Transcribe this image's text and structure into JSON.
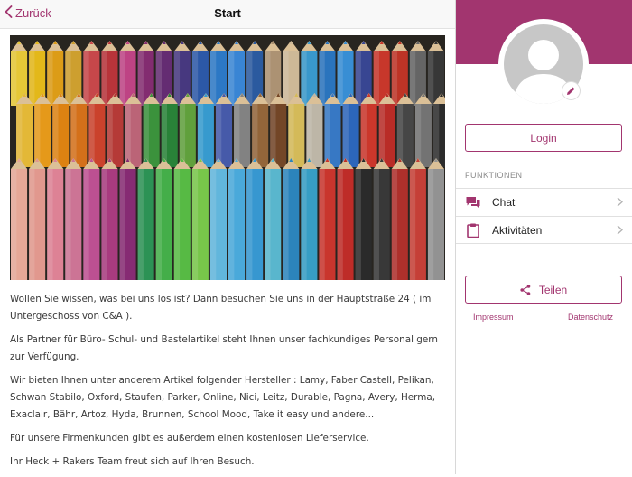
{
  "navbar": {
    "back_label": "Zurück",
    "title": "Start"
  },
  "hero": {
    "icon": "colored-pencils-photo"
  },
  "content": {
    "paragraphs": [
      "Wollen Sie wissen, was bei uns los ist? Dann besuchen Sie uns in der Hauptstraße 24 ( im Untergeschoss von C&A ).",
      "Als Partner für Büro- Schul- und Bastelartikel steht Ihnen unser fachkundiges Personal gern zur Verfügung.",
      "Wir bieten Ihnen unter anderem Artikel folgender Hersteller : Lamy, Faber Castell, Pelikan, Schwan Stabilo, Oxford, Staufen, Parker, Online, Nici, Leitz, Durable, Pagna, Avery, Herma, Exaclair, Bähr, Artoz, Hyda, Brunnen, School Mood, Take it easy und andere...",
      "Für unsere Firmenkunden gibt es außerdem einen kostenlosen Lieferservice.",
      "Ihr Heck + Rakers Team freut sich auf Ihren Besuch."
    ]
  },
  "sidebar": {
    "accent_color": "#a2356f",
    "login_label": "Login",
    "section_label": "FUNKTIONEN",
    "menu": [
      {
        "label": "Chat",
        "icon": "chat-icon"
      },
      {
        "label": "Aktivitäten",
        "icon": "clipboard-icon"
      }
    ],
    "share_label": "Teilen",
    "impressum_label": "Impressum",
    "datenschutz_label": "Datenschutz"
  }
}
